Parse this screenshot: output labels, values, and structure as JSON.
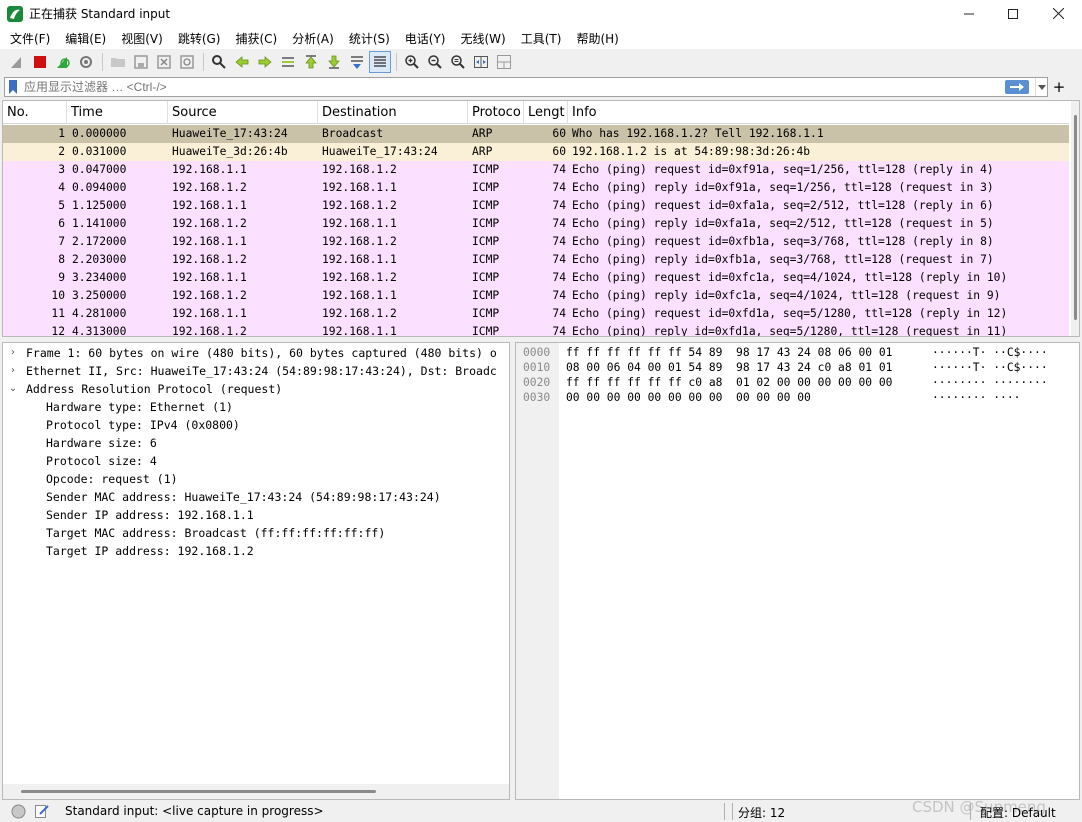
{
  "window": {
    "title": "正在捕获 Standard input",
    "controls": {
      "minimize": "—",
      "maximize": "☐",
      "close": "✕"
    }
  },
  "menu": [
    "文件(F)",
    "编辑(E)",
    "视图(V)",
    "跳转(G)",
    "捕获(C)",
    "分析(A)",
    "统计(S)",
    "电话(Y)",
    "无线(W)",
    "工具(T)",
    "帮助(H)"
  ],
  "toolbar": {
    "icons": [
      "shark-fin-icon",
      "stop-icon",
      "restart-icon",
      "options-icon",
      "open-icon",
      "save-icon",
      "close-file-icon",
      "reload-icon",
      "find-icon",
      "go-back-icon",
      "go-forward-icon",
      "go-to-packet-icon",
      "first-packet-icon",
      "last-packet-icon",
      "autoscroll-icon",
      "colorize-icon",
      "zoom-in-icon",
      "zoom-out-icon",
      "zoom-normal-icon",
      "resize-columns-icon",
      "layout-icon"
    ]
  },
  "filter": {
    "placeholder": "应用显示过滤器 … <Ctrl-/>",
    "apply_icon": "arrow-right-icon",
    "plus": "+"
  },
  "packet_list": {
    "columns": [
      "No.",
      "Time",
      "Source",
      "Destination",
      "Protoco",
      "Lengt",
      "Info"
    ],
    "rows": [
      {
        "no": "1",
        "time": "0.000000",
        "source": "HuaweiTe_17:43:24",
        "destination": "Broadcast",
        "protocol": "ARP",
        "length": "60",
        "info": "Who has 192.168.1.2? Tell 192.168.1.1",
        "bg": "#c9c1a8"
      },
      {
        "no": "2",
        "time": "0.031000",
        "source": "HuaweiTe_3d:26:4b",
        "destination": "HuaweiTe_17:43:24",
        "protocol": "ARP",
        "length": "60",
        "info": "192.168.1.2 is at 54:89:98:3d:26:4b",
        "bg": "#faf0d7"
      },
      {
        "no": "3",
        "time": "0.047000",
        "source": "192.168.1.1",
        "destination": "192.168.1.2",
        "protocol": "ICMP",
        "length": "74",
        "info": "Echo (ping) request  id=0xf91a, seq=1/256, ttl=128 (reply in 4)",
        "bg": "#fce0ff"
      },
      {
        "no": "4",
        "time": "0.094000",
        "source": "192.168.1.2",
        "destination": "192.168.1.1",
        "protocol": "ICMP",
        "length": "74",
        "info": "Echo (ping) reply    id=0xf91a, seq=1/256, ttl=128 (request in 3)",
        "bg": "#fce0ff"
      },
      {
        "no": "5",
        "time": "1.125000",
        "source": "192.168.1.1",
        "destination": "192.168.1.2",
        "protocol": "ICMP",
        "length": "74",
        "info": "Echo (ping) request  id=0xfa1a, seq=2/512, ttl=128 (reply in 6)",
        "bg": "#fce0ff"
      },
      {
        "no": "6",
        "time": "1.141000",
        "source": "192.168.1.2",
        "destination": "192.168.1.1",
        "protocol": "ICMP",
        "length": "74",
        "info": "Echo (ping) reply    id=0xfa1a, seq=2/512, ttl=128 (request in 5)",
        "bg": "#fce0ff"
      },
      {
        "no": "7",
        "time": "2.172000",
        "source": "192.168.1.1",
        "destination": "192.168.1.2",
        "protocol": "ICMP",
        "length": "74",
        "info": "Echo (ping) request  id=0xfb1a, seq=3/768, ttl=128 (reply in 8)",
        "bg": "#fce0ff"
      },
      {
        "no": "8",
        "time": "2.203000",
        "source": "192.168.1.2",
        "destination": "192.168.1.1",
        "protocol": "ICMP",
        "length": "74",
        "info": "Echo (ping) reply    id=0xfb1a, seq=3/768, ttl=128 (request in 7)",
        "bg": "#fce0ff"
      },
      {
        "no": "9",
        "time": "3.234000",
        "source": "192.168.1.1",
        "destination": "192.168.1.2",
        "protocol": "ICMP",
        "length": "74",
        "info": "Echo (ping) request  id=0xfc1a, seq=4/1024, ttl=128 (reply in 10)",
        "bg": "#fce0ff"
      },
      {
        "no": "10",
        "time": "3.250000",
        "source": "192.168.1.2",
        "destination": "192.168.1.1",
        "protocol": "ICMP",
        "length": "74",
        "info": "Echo (ping) reply    id=0xfc1a, seq=4/1024, ttl=128 (request in 9)",
        "bg": "#fce0ff"
      },
      {
        "no": "11",
        "time": "4.281000",
        "source": "192.168.1.1",
        "destination": "192.168.1.2",
        "protocol": "ICMP",
        "length": "74",
        "info": "Echo (ping) request  id=0xfd1a, seq=5/1280, ttl=128 (reply in 12)",
        "bg": "#fce0ff"
      },
      {
        "no": "12",
        "time": "4.313000",
        "source": "192.168.1.2",
        "destination": "192.168.1.1",
        "protocol": "ICMP",
        "length": "74",
        "info": "Echo (ping) reply    id=0xfd1a, seq=5/1280, ttl=128 (request in 11)",
        "bg": "#fce0ff"
      }
    ]
  },
  "details": {
    "rows": [
      {
        "arrow": "›",
        "text": "Frame 1: 60 bytes on wire (480 bits), 60 bytes captured (480 bits) o",
        "level": 0
      },
      {
        "arrow": "›",
        "text": "Ethernet II, Src: HuaweiTe_17:43:24 (54:89:98:17:43:24), Dst: Broadc",
        "level": 0
      },
      {
        "arrow": "⌄",
        "text": "Address Resolution Protocol (request)",
        "level": 0
      },
      {
        "arrow": "",
        "text": "Hardware type: Ethernet (1)",
        "level": 1
      },
      {
        "arrow": "",
        "text": "Protocol type: IPv4 (0x0800)",
        "level": 1
      },
      {
        "arrow": "",
        "text": "Hardware size: 6",
        "level": 1
      },
      {
        "arrow": "",
        "text": "Protocol size: 4",
        "level": 1
      },
      {
        "arrow": "",
        "text": "Opcode: request (1)",
        "level": 1
      },
      {
        "arrow": "",
        "text": "Sender MAC address: HuaweiTe_17:43:24 (54:89:98:17:43:24)",
        "level": 1
      },
      {
        "arrow": "",
        "text": "Sender IP address: 192.168.1.1",
        "level": 1
      },
      {
        "arrow": "",
        "text": "Target MAC address: Broadcast (ff:ff:ff:ff:ff:ff)",
        "level": 1
      },
      {
        "arrow": "",
        "text": "Target IP address: 192.168.1.2",
        "level": 1
      }
    ]
  },
  "bytes": {
    "rows": [
      {
        "offset": "0000",
        "hex": "ff ff ff ff ff ff 54 89  98 17 43 24 08 06 00 01",
        "ascii": "······T· ··C$····"
      },
      {
        "offset": "0010",
        "hex": "08 00 06 04 00 01 54 89  98 17 43 24 c0 a8 01 01",
        "ascii": "······T· ··C$····"
      },
      {
        "offset": "0020",
        "hex": "ff ff ff ff ff ff c0 a8  01 02 00 00 00 00 00 00",
        "ascii": "········ ········"
      },
      {
        "offset": "0030",
        "hex": "00 00 00 00 00 00 00 00  00 00 00 00",
        "ascii": "········ ····"
      }
    ]
  },
  "status": {
    "capture_text": "Standard input: <live capture in progress>",
    "packets": "分组: 12",
    "profile": "配置: Default",
    "watermark": "CSDN @Sunmeng"
  },
  "colors": {
    "selected_row": "#c9c1a8",
    "arp_row": "#faf0d7",
    "icmp_row": "#fce0ff",
    "filter_apply": "#6699cc"
  }
}
